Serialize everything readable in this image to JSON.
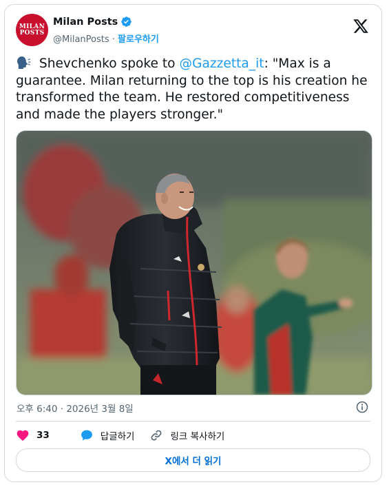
{
  "account": {
    "display_name": "Milan Posts",
    "handle": "@MilanPosts",
    "separator": " · ",
    "follow_label": "팔로우하기",
    "avatar_line1": "MILAN",
    "avatar_line2": "POSTS",
    "verified_icon": "verified-badge-icon"
  },
  "tweet": {
    "text_part1": " Shevchenko spoke to ",
    "mention": "@Gazzetta_it",
    "text_part2": ": \"Max is a guarantee. Milan returning to the top is his creation he transformed the team. He restored competitiveness and made the players stronger.\"",
    "emoji_icon": "speaking-head-icon"
  },
  "media": {
    "icon": "photo"
  },
  "meta": {
    "timestamp": "오후 6:40 · 2026년 3월 8일"
  },
  "actions": {
    "like_count": "33",
    "reply_label": "답글하기",
    "copy_link_label": "링크 복사하기"
  },
  "read_more": "X에서 더 읽기",
  "colors": {
    "accent": "#1d9bf0",
    "like": "#f91880",
    "brand": "#c8102e"
  }
}
